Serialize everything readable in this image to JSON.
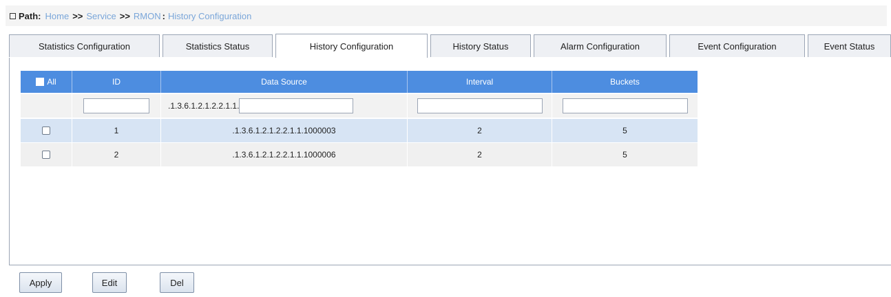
{
  "path": {
    "label": "Path:",
    "crumbs": [
      "Home",
      "Service",
      "RMON"
    ],
    "separator": ">>",
    "current_sep": ":",
    "current": "History Configuration"
  },
  "tabs": [
    {
      "label": "Statistics Configuration",
      "active": false
    },
    {
      "label": "Statistics Status",
      "active": false
    },
    {
      "label": "History Configuration",
      "active": true
    },
    {
      "label": "History Status",
      "active": false
    },
    {
      "label": "Alarm Configuration",
      "active": false
    },
    {
      "label": "Event Configuration",
      "active": false
    },
    {
      "label": "Event Status",
      "active": false
    }
  ],
  "table": {
    "headers": {
      "all": "All",
      "id": "ID",
      "data_source": "Data Source",
      "interval": "Interval",
      "buckets": "Buckets"
    },
    "filter": {
      "id": "",
      "data_source_prefix": ".1.3.6.1.2.1.2.2.1.1.",
      "data_source": "",
      "interval": "",
      "buckets": ""
    },
    "rows": [
      {
        "id": "1",
        "data_source": ".1.3.6.1.2.1.2.2.1.1.1000003",
        "interval": "2",
        "buckets": "5",
        "selected": false
      },
      {
        "id": "2",
        "data_source": ".1.3.6.1.2.1.2.2.1.1.1000006",
        "interval": "2",
        "buckets": "5",
        "selected": false
      }
    ]
  },
  "buttons": {
    "apply": "Apply",
    "edit": "Edit",
    "del": "Del"
  }
}
